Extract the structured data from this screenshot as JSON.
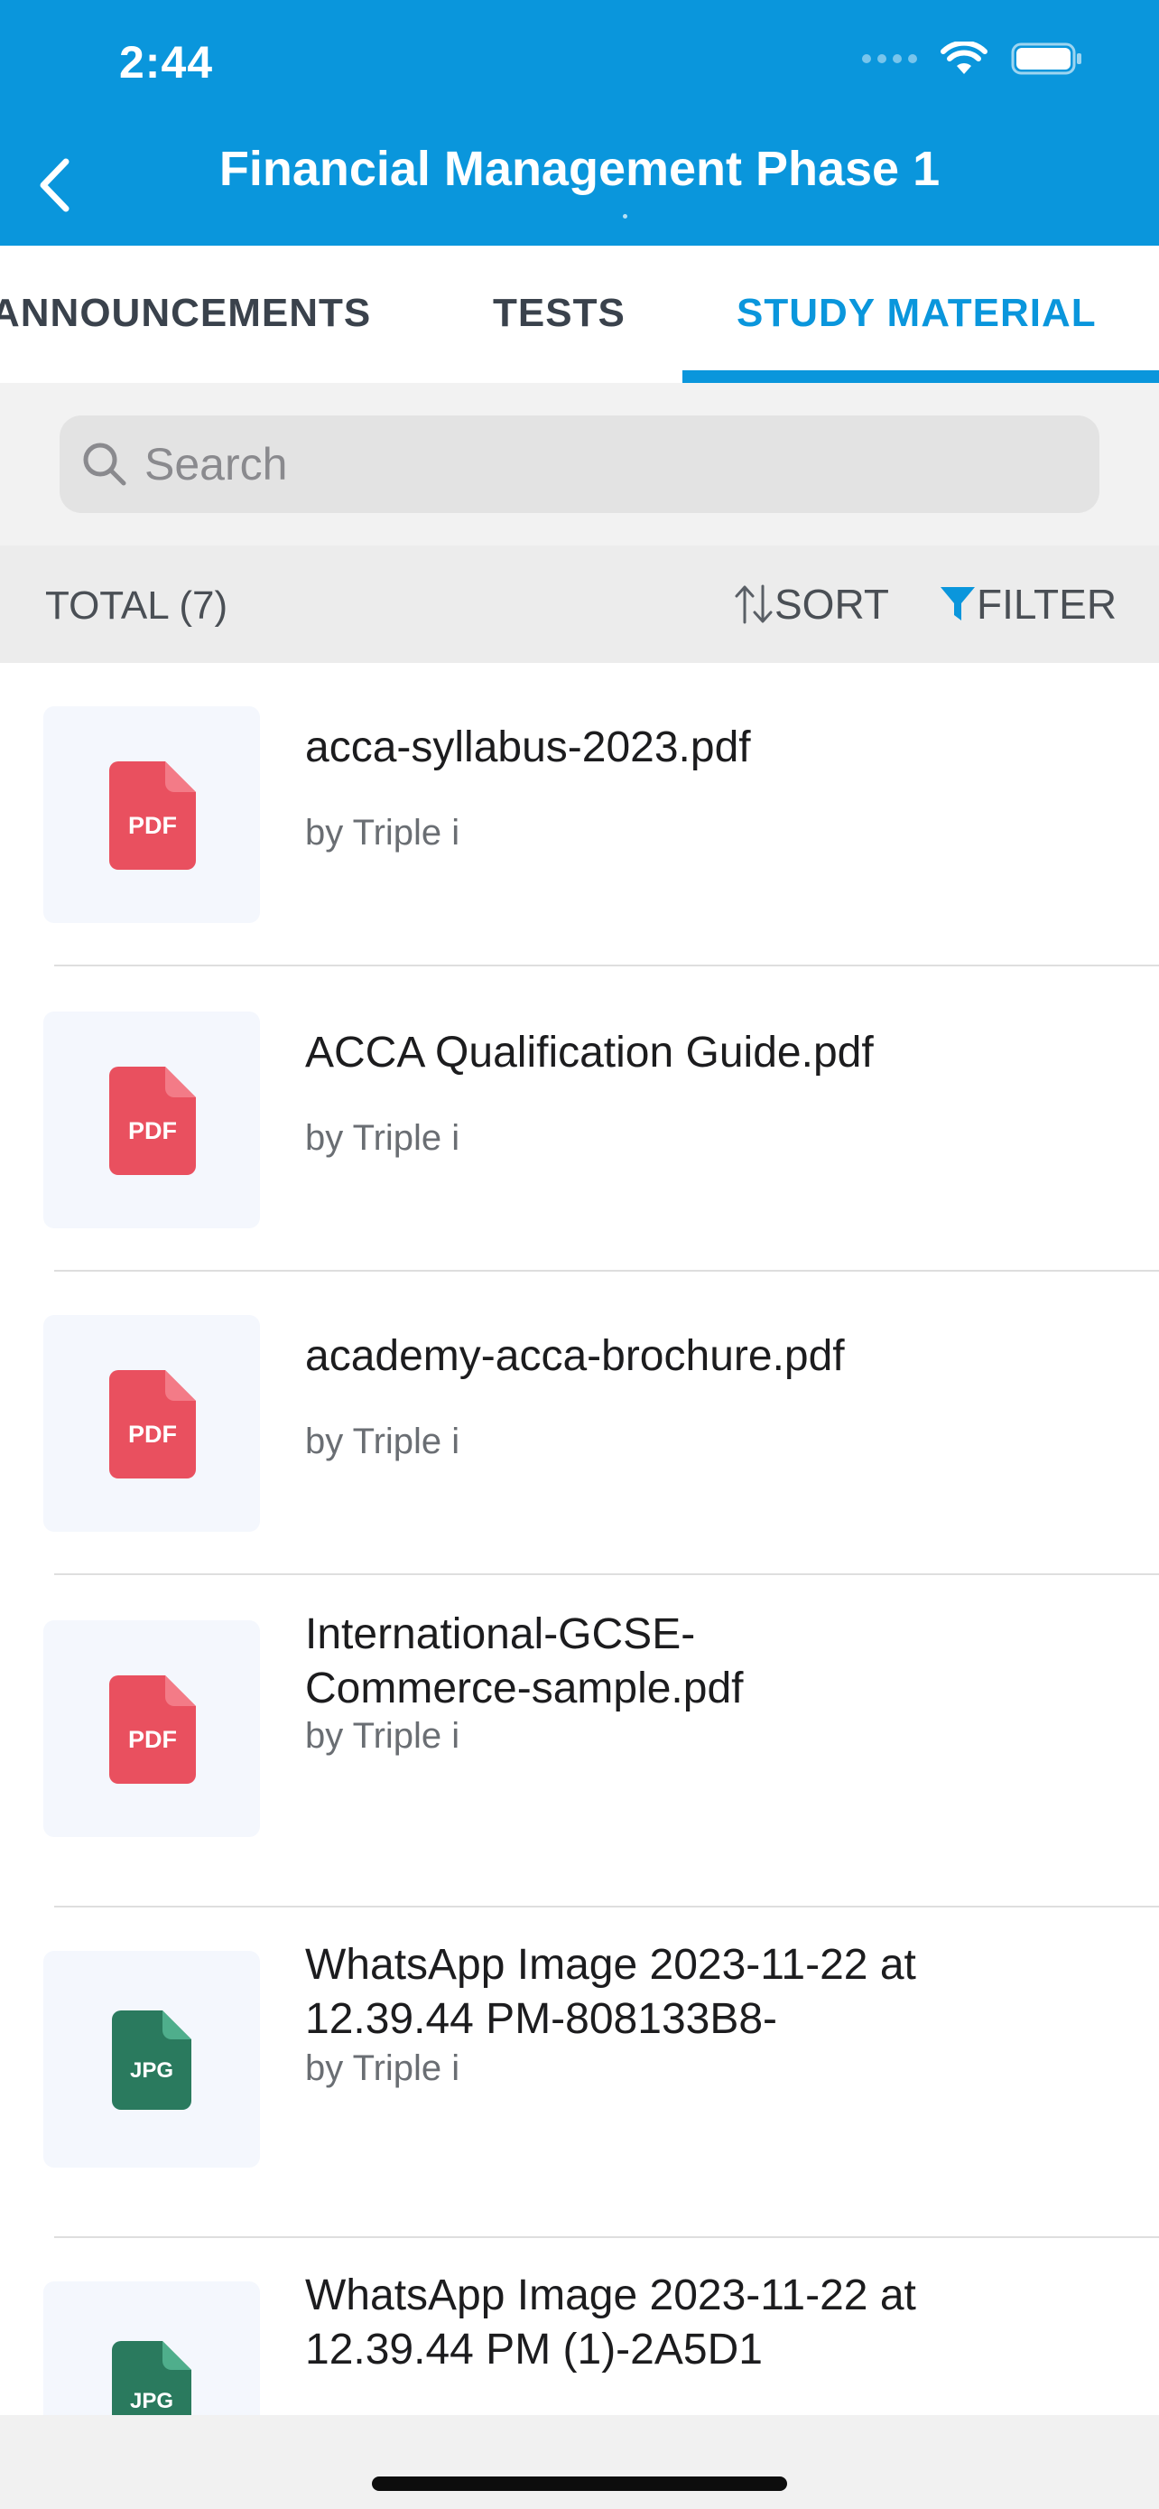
{
  "status_bar": {
    "time": "2:44",
    "icons": [
      "cellular-signal-icon",
      "wifi-icon",
      "battery-icon"
    ]
  },
  "header": {
    "title": "Financial Management Phase 1",
    "back_icon": "chevron-left-icon",
    "background_color": "#0a96dc"
  },
  "tabs": [
    {
      "label": "ANNOUNCEMENTS",
      "active": false
    },
    {
      "label": "TESTS",
      "active": false
    },
    {
      "label": "STUDY MATERIAL",
      "active": true
    }
  ],
  "search": {
    "placeholder": "Search",
    "value": ""
  },
  "toolbar": {
    "total_label": "TOTAL (7)",
    "sort_label": "SORT",
    "filter_label": "FILTER"
  },
  "files": [
    {
      "type": "PDF",
      "title_line1": "acca-syllabus-2023.pdf",
      "title_line2": "",
      "author": "by Triple i"
    },
    {
      "type": "PDF",
      "title_line1": "ACCA Qualification Guide.pdf",
      "title_line2": "",
      "author": "by Triple i"
    },
    {
      "type": "PDF",
      "title_line1": "academy-acca-brochure.pdf",
      "title_line2": "",
      "author": "by Triple i"
    },
    {
      "type": "PDF",
      "title_line1": "International-GCSE-",
      "title_line2": "Commerce-sample.pdf",
      "author": "by Triple i"
    },
    {
      "type": "JPG",
      "title_line1": "WhatsApp Image 2023-11-22 at",
      "title_line2": "12.39.44 PM-808133B8-",
      "author": "by Triple i"
    },
    {
      "type": "JPG",
      "title_line1": "WhatsApp Image 2023-11-22 at",
      "title_line2": "12.39.44 PM (1)-2A5D1",
      "author": ""
    }
  ],
  "colors": {
    "accent": "#0a96dc",
    "pdf_icon": "#e9505f",
    "jpg_icon": "#2e8a6a"
  }
}
